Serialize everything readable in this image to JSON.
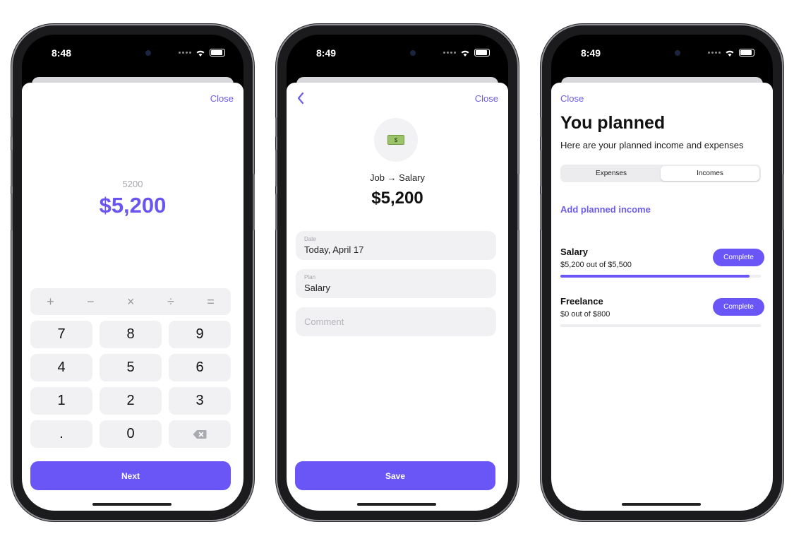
{
  "screens": [
    {
      "status_time": "8:48",
      "close_label": "Close",
      "raw_value": "5200",
      "amount": "$5,200",
      "operators": [
        "+",
        "−",
        "×",
        "÷",
        "="
      ],
      "keys": [
        "7",
        "8",
        "9",
        "4",
        "5",
        "6",
        "1",
        "2",
        "3",
        ".",
        "0"
      ],
      "backspace_icon": "backspace-icon",
      "next_label": "Next"
    },
    {
      "status_time": "8:49",
      "close_label": "Close",
      "back_icon": "chevron-left-icon",
      "emoji_icon": "money-bill-icon",
      "route": "Job → Salary",
      "amount": "$5,200",
      "date_label": "Date",
      "date_value": "Today, April 17",
      "plan_label": "Plan",
      "plan_value": "Salary",
      "comment_placeholder": "Comment",
      "save_label": "Save"
    },
    {
      "status_time": "8:49",
      "close_label": "Close",
      "title": "You planned",
      "subtitle": "Here are your planned income and expenses",
      "segments": [
        "Expenses",
        "Incomes"
      ],
      "active_segment": "Incomes",
      "add_link": "Add planned income",
      "plans": [
        {
          "name": "Salary",
          "progress_text": "$5,200 out of $5,500",
          "complete_label": "Complete",
          "progress": 0.945
        },
        {
          "name": "Freelance",
          "progress_text": "$0 out of $800",
          "complete_label": "Complete",
          "progress": 0
        }
      ]
    }
  ],
  "colors": {
    "accent": "#6a55f7",
    "link": "#6c5ce7",
    "field_bg": "#f1f1f4"
  }
}
